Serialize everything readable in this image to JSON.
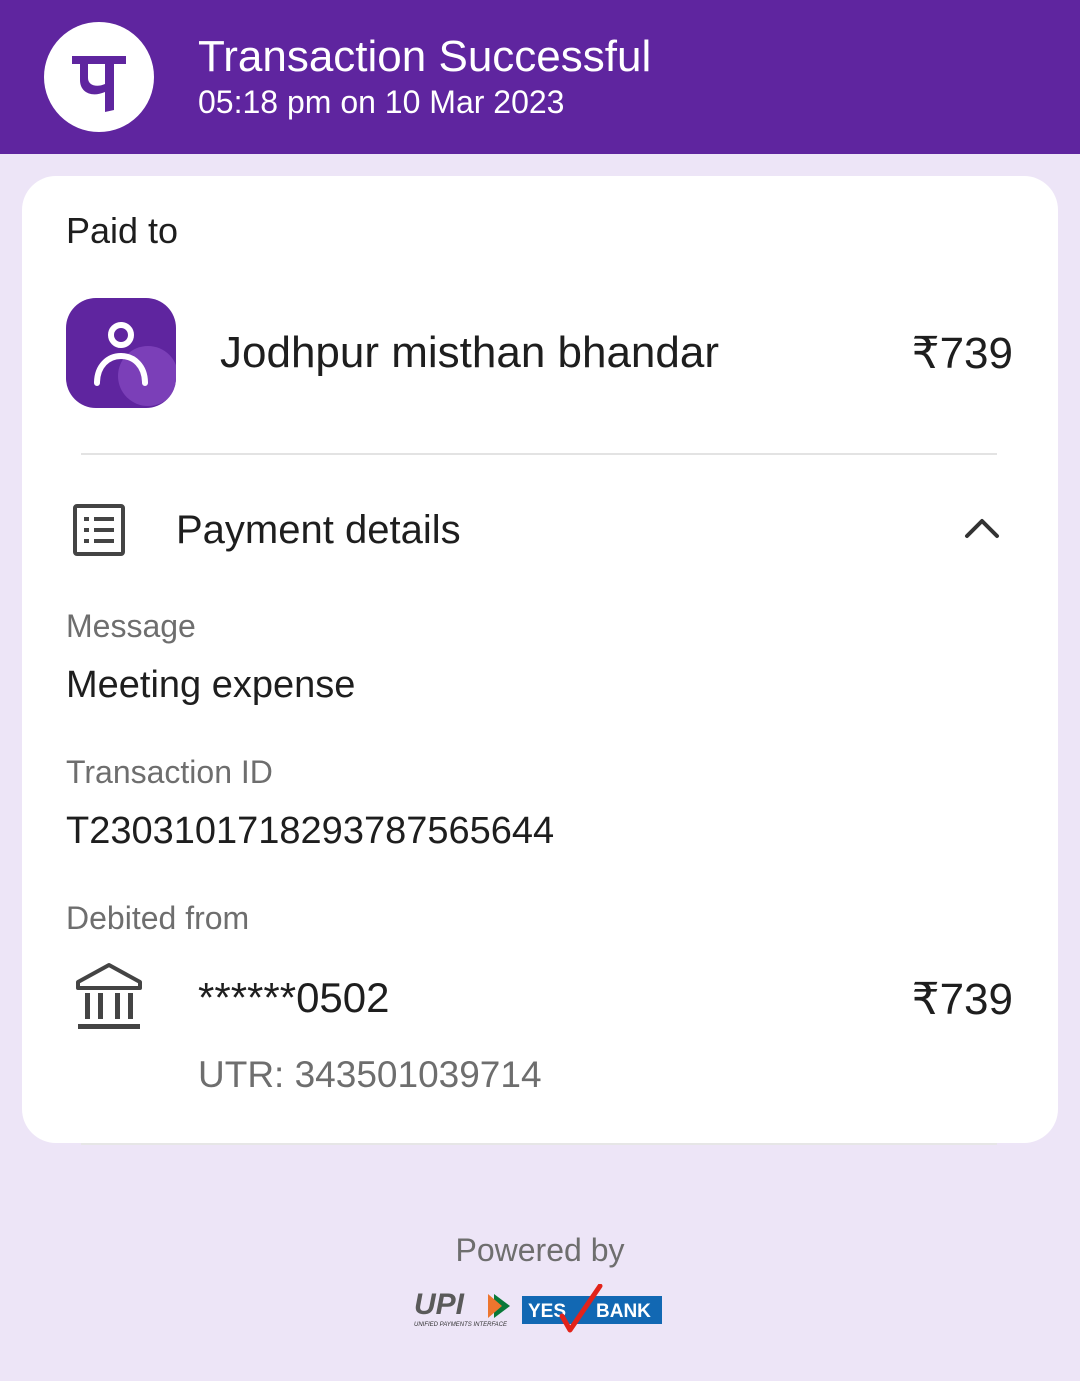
{
  "header": {
    "logo_icon": "phonepe-logo-icon",
    "title": "Transaction Successful",
    "datetime": "05:18 pm on 10 Mar 2023",
    "background_color": "#5f259f"
  },
  "paid_to": {
    "label": "Paid to",
    "avatar_icon": "person-icon",
    "payee_name": "Jodhpur misthan bhandar",
    "amount": "₹739"
  },
  "payment_details": {
    "icon": "receipt-list-icon",
    "label": "Payment details",
    "toggle_icon": "chevron-up-icon",
    "expanded": true,
    "fields": [
      {
        "label": "Message",
        "value": "Meeting expense"
      },
      {
        "label": "Transaction ID",
        "value": "T2303101718293787565644"
      }
    ],
    "debited_from": {
      "label": "Debited from",
      "bank_icon": "bank-icon",
      "account": "******0502",
      "amount": "₹739",
      "utr": "UTR: 343501039714"
    }
  },
  "footer": {
    "powered_by": "Powered by",
    "upi_logo_text": "UPI",
    "upi_logo_subtext": "UNIFIED PAYMENTS INTERFACE",
    "bank_logo_text_1": "YES",
    "bank_logo_text_2": "BANK"
  },
  "colors": {
    "brand_purple": "#5f259f",
    "page_background": "#ede5f7",
    "card_background": "#ffffff",
    "bank_blue": "#1268b3",
    "bank_red": "#e2231a"
  }
}
